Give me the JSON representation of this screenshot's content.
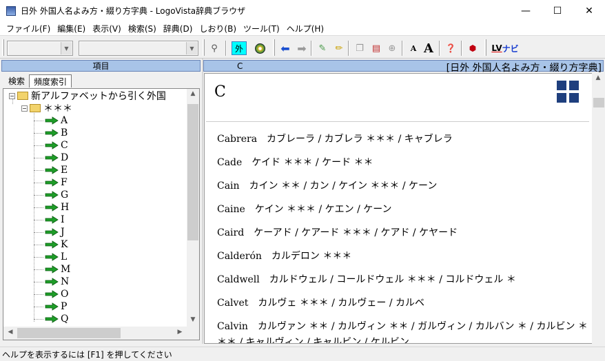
{
  "window": {
    "title": "日外 外国人名よみ方・綴り方字典 - LogoVista辞典ブラウザ",
    "minimize": "—",
    "maximize": "☐",
    "close": "✕"
  },
  "menu": [
    "ファイル(F)",
    "編集(E)",
    "表示(V)",
    "検索(S)",
    "辞典(D)",
    "しおり(B)",
    "ツール(T)",
    "ヘルプ(H)"
  ],
  "toolbar": {
    "search_glyph": "👓",
    "gai_label": "外",
    "lv_label": "LV",
    "navi_label": "ナビ",
    "font_small": "A",
    "font_large": "A",
    "help_glyph": "❓"
  },
  "left": {
    "header": "項目",
    "tabs": [
      "検索",
      "頻度索引"
    ],
    "root_label": "新アルファベットから引く外国",
    "sub_label": "＊＊＊",
    "letters": [
      "A",
      "B",
      "C",
      "D",
      "E",
      "F",
      "G",
      "H",
      "I",
      "J",
      "K",
      "L",
      "M",
      "N",
      "O",
      "P",
      "Q"
    ]
  },
  "right": {
    "header_left": "C",
    "header_right": "[日外 外国人名よみ方・綴り方字典]",
    "entry_title": "C",
    "entries": [
      {
        "name": "Cabrera",
        "kana": "カブレーラ / カブレラ ＊＊＊ / キャブレラ"
      },
      {
        "name": "Cade",
        "kana": "ケイド ＊＊＊ / ケード ＊＊"
      },
      {
        "name": "Cain",
        "kana": "カイン ＊＊ / カン / ケイン ＊＊＊ / ケーン"
      },
      {
        "name": "Caine",
        "kana": "ケイン ＊＊＊ / ケエン / ケーン"
      },
      {
        "name": "Caird",
        "kana": "ケーアド / ケアード ＊＊＊ / ケアド / ケヤード"
      },
      {
        "name": "Calderón",
        "kana": "カルデロン ＊＊＊"
      },
      {
        "name": "Caldwell",
        "kana": "カルドウェル / コールドウェル ＊＊＊ / コルドウェル ＊"
      },
      {
        "name": "Calvet",
        "kana": "カルヴェ ＊＊＊ / カルヴェー / カルベ"
      },
      {
        "name": "Calvin",
        "kana": "カルヴァン ＊＊ / カルヴィン ＊＊ / ガルヴィン / カルバン ＊ / カルビン ＊＊＊ / キャルヴィン / キャルビン / ケルビン"
      }
    ]
  },
  "status": "ヘルプを表示するには [F1] を押してください"
}
